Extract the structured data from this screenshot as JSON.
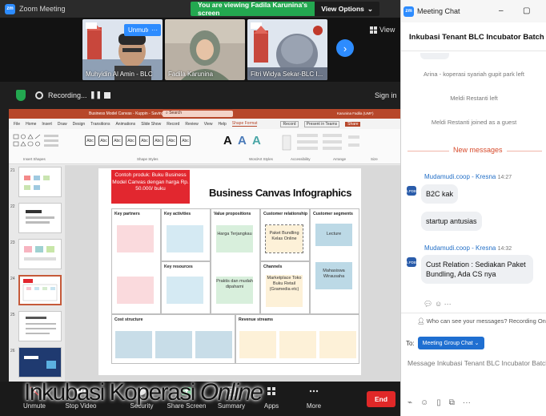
{
  "zoom": {
    "window_title": "Zoom Meeting",
    "viewing_banner": "You are viewing Fadila Karunina's screen",
    "view_options": "View Options",
    "view_label": "View",
    "participants": [
      {
        "name": "Muhyidin Al Amin - BLC"
      },
      {
        "name": "Fadila Karunina"
      },
      {
        "name": "Fitri Widya Sekar-BLC I..."
      }
    ],
    "unmute_chip": "Unmute",
    "more_chip": "···",
    "recording_label": "Recording...",
    "sign_in": "Sign in",
    "toolbar": [
      {
        "label": "Unmute"
      },
      {
        "label": "Stop Video"
      },
      {
        "label": "Security"
      },
      {
        "label": "Share Screen"
      },
      {
        "label": "Summary"
      },
      {
        "label": "Apps"
      },
      {
        "label": "More"
      }
    ],
    "end_label": "End"
  },
  "caption": {
    "main": "Inkubasi Koperasi",
    "italic": "Online"
  },
  "ppt": {
    "title_bar": "Business Model Canvas - Kuppin - Saving... ▾",
    "search": "Search",
    "menu": [
      "File",
      "Home",
      "Insert",
      "Draw",
      "Design",
      "Transitions",
      "Animations",
      "Slide Show",
      "Record",
      "Review",
      "View",
      "Help",
      "Shape Format"
    ],
    "ribbon_groups": [
      "Insert Shapes",
      "Shape Styles",
      "WordArt Styles",
      "Accessibility",
      "Arrange",
      "Size"
    ],
    "record_btn": "Record",
    "present_btn": "Present in Teams",
    "share_btn": "Share",
    "user": "Karunina Fadila (UMF)",
    "wordart_glyphs": [
      "A",
      "A",
      "A"
    ],
    "slide_numbers": [
      "21",
      "22",
      "23",
      "24",
      "25",
      "26"
    ],
    "slide": {
      "note": "Contoh produk: Buku Business Model Canvas dengan harga Rp. 50.000/ buku",
      "title": "Business Canvas Infographics",
      "labels": {
        "key_partners": "Key partners",
        "key_activities": "Key activities",
        "value_propositions": "Value propositions",
        "customer_relationship": "Customer relationship",
        "customer_segments": "Customer segments",
        "key_resources": "Key resources",
        "channels": "Channels",
        "cost_structure": "Cost structure",
        "revenue_streams": "Revenue streams"
      },
      "stickies": {
        "harga": "Harga Terjangkau",
        "paket": "Paket Bundling Kelas Online",
        "lecture": "Lecture",
        "praktis": "Praktis dan mudah dipahami",
        "marketplace": "Marketplace Toko Buku Retail (Gramedia etc)",
        "mahasiswa": "Mahasiswa Wirausaha"
      }
    }
  },
  "chat": {
    "window_title": "Meeting Chat",
    "header": "Inkubasi Tenant BLC Incubator Batch 10.",
    "system_messages": [
      "Arina - koperasi syariah gupit park left",
      "Meldi Restanti left",
      "Meldi Restanti joined as a guest"
    ],
    "new_messages": "New messages",
    "messages": [
      {
        "sender": "Mudamudi.coop - Kresna",
        "time": "14:27",
        "texts": [
          "B2C kak",
          "startup antusias"
        ]
      },
      {
        "sender": "Mudamudi.coop - Kresna",
        "time": "14:32",
        "texts": [
          "Cust Relation : Sediakan Paket Bundling, Ada CS nya"
        ]
      }
    ],
    "avatar_text": "LPDB",
    "who_can_see": "Who can see your messages? Recording On",
    "to_label": "To:",
    "to_recipient": "Meeting Group Chat",
    "input_placeholder": "Message Inkubasi Tenant BLC Incubator Batch 10."
  },
  "colors": {
    "zoom_blue": "#2d8cff",
    "banner_green": "#23a850",
    "end_red": "#e02828",
    "ppt_brand": "#b7472a",
    "note_red": "#e2272f",
    "new_msg": "#d74b2c"
  }
}
